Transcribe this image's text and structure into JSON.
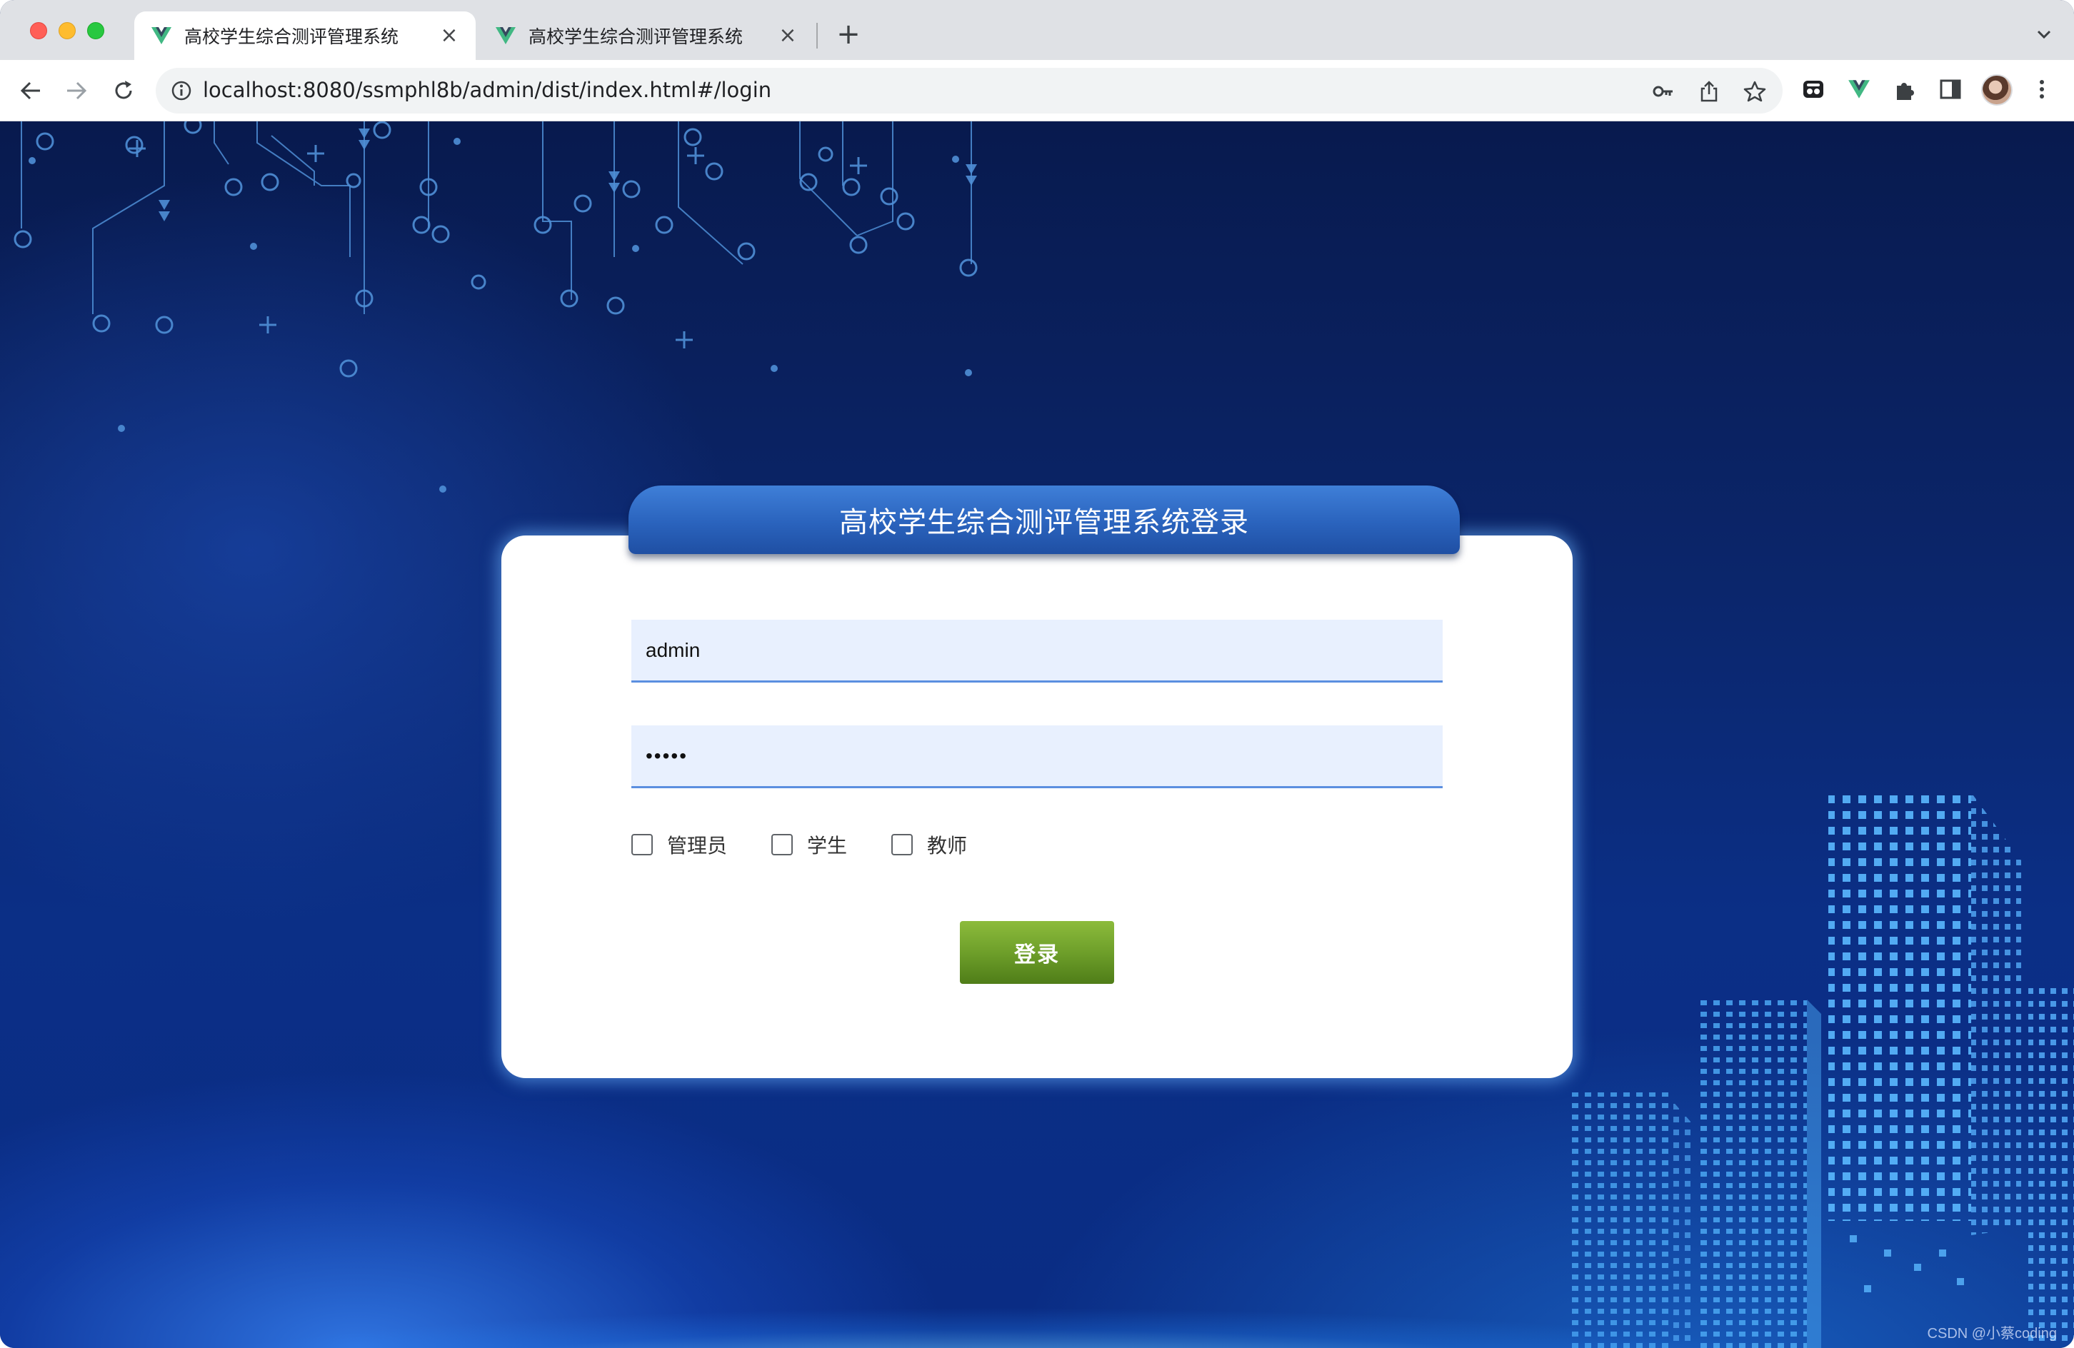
{
  "browser": {
    "tabs": [
      {
        "title": "高校学生综合测评管理系统",
        "active": true
      },
      {
        "title": "高校学生综合测评管理系统",
        "active": false
      }
    ],
    "tab_close_symbol": "×",
    "new_tab_symbol": "+",
    "url": "localhost:8080/ssmphl8b/admin/dist/index.html#/login",
    "icons": [
      "back-icon",
      "forward-icon",
      "reload-icon",
      "site-info-icon",
      "key-icon",
      "share-icon",
      "bookmark-star-icon",
      "extension-tab-icon",
      "vue-devtools-icon",
      "extensions-puzzle-icon",
      "sidebar-icon",
      "avatar",
      "menu-kebab-icon",
      "tab-search-chevron-icon"
    ]
  },
  "login": {
    "title": "高校学生综合测评管理系统登录",
    "username_value": "admin",
    "password_value": "•••••",
    "roles": [
      "管理员",
      "学生",
      "教师"
    ],
    "submit_label": "登录"
  },
  "watermark": "CSDN @小蔡coding",
  "colors": {
    "header_blue": "#2a63bd",
    "button_green": "#6e9f2a",
    "input_bg": "#e8f0fe",
    "page_bg": "#0b2569"
  }
}
